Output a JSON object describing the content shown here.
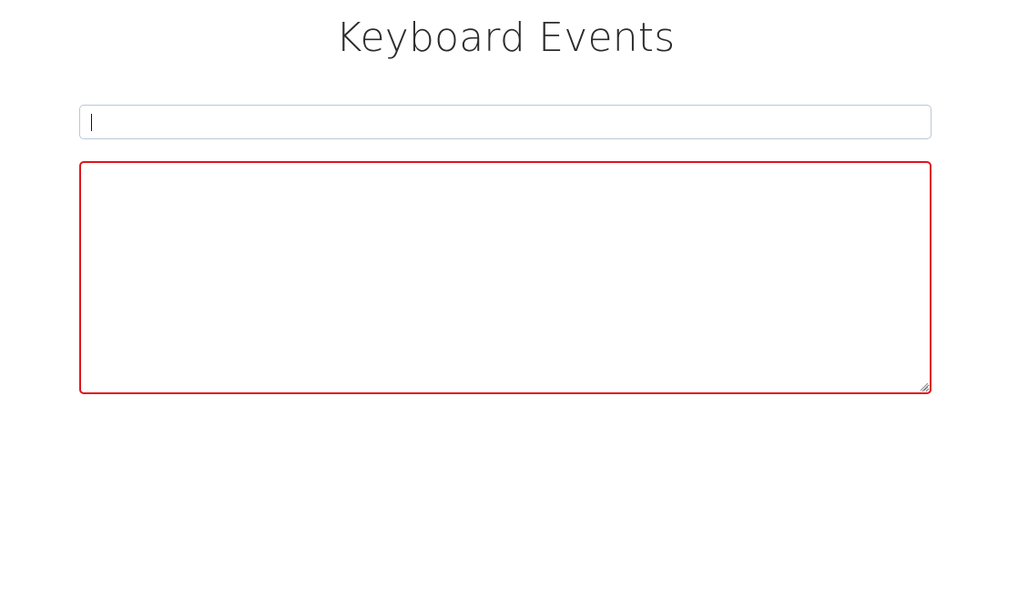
{
  "header": {
    "title": "Keyboard Events"
  },
  "input": {
    "value": "",
    "placeholder": ""
  },
  "log": {
    "value": "",
    "placeholder": ""
  },
  "colors": {
    "input_border": "#b9c7d6",
    "textarea_border": "#e0141a",
    "title_text": "#2b2b2b"
  }
}
